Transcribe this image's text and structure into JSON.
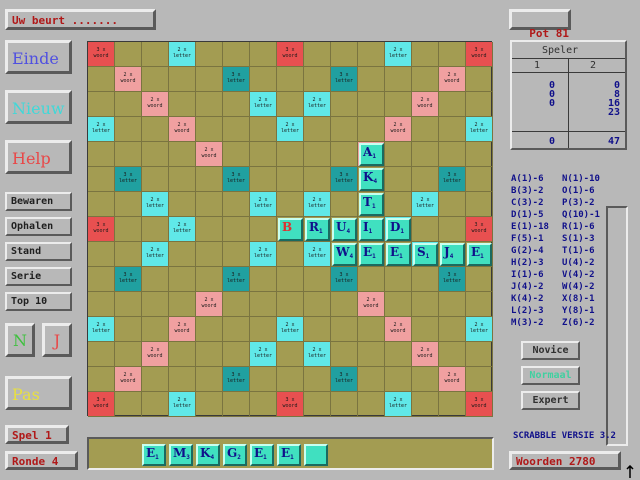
{
  "status_top": "Uw beurt .......",
  "pot": {
    "label": "Pot",
    "value": "81"
  },
  "buttons": {
    "einde": "Einde",
    "nieuw": "Nieuw",
    "help": "Help",
    "bewaren": "Bewaren",
    "ophalen": "Ophalen",
    "stand": "Stand",
    "serie": "Serie",
    "top10": "Top 10",
    "n": "N",
    "j": "J",
    "pas": "Pas"
  },
  "spel": "Spel 1",
  "ronde": "Ronde 4",
  "score": {
    "title": "Speler",
    "col1": "1",
    "col2": "2",
    "p1": [
      "0",
      "0",
      "0"
    ],
    "p2": [
      "0",
      "8",
      "16",
      "23"
    ],
    "total1": "0",
    "total2": "47"
  },
  "letter_values_left": [
    "A(1)-6",
    "B(3)-2",
    "C(3)-2",
    "D(1)-5",
    "E(1)-18",
    "F(5)-1",
    "G(2)-4",
    "H(2)-3",
    "I(1)-6",
    "J(4)-2",
    "K(4)-2",
    "L(2)-3",
    "M(3)-2"
  ],
  "letter_values_right": [
    "N(1)-10",
    "O(1)-6",
    "P(3)-2",
    "Q(10)-1",
    "R(1)-6",
    "S(1)-3",
    "T(1)-6",
    "U(4)-2",
    "V(4)-2",
    "W(4)-2",
    "X(8)-1",
    "Y(8)-1",
    "Z(6)-2"
  ],
  "levels": {
    "novice": "Novice",
    "normaal": "Normaal",
    "expert": "Expert"
  },
  "version": "SCRABBLE VERSIE 3.2",
  "woorden": "Woorden 2780",
  "bonus_labels": {
    "wt": "3 x woord",
    "dw": "2 x woord",
    "tl": "3 x letter",
    "dl": "2 x letter"
  },
  "colors": {
    "board": "#a39c52",
    "tw": "#e85050",
    "dw": "#f0a0a0",
    "tl": "#20a0a0",
    "dl": "#60e8e8",
    "tile": "#40e0c0"
  },
  "placed_tiles": [
    {
      "letter": "A",
      "value": "1"
    },
    {
      "letter": "K",
      "value": "4"
    },
    {
      "letter": "T",
      "value": "1"
    },
    {
      "letter": "B",
      "value": ""
    },
    {
      "letter": "R",
      "value": "1"
    },
    {
      "letter": "U",
      "value": "4"
    },
    {
      "letter": "I",
      "value": "1"
    },
    {
      "letter": "D",
      "value": "1"
    },
    {
      "letter": "W",
      "value": "4"
    },
    {
      "letter": "E",
      "value": "1"
    },
    {
      "letter": "E",
      "value": "1"
    },
    {
      "letter": "S",
      "value": "1"
    },
    {
      "letter": "J",
      "value": "4"
    },
    {
      "letter": "E",
      "value": "1"
    }
  ],
  "rack": [
    {
      "letter": "E",
      "value": "1"
    },
    {
      "letter": "M",
      "value": "3"
    },
    {
      "letter": "K",
      "value": "4"
    },
    {
      "letter": "G",
      "value": "2"
    },
    {
      "letter": "E",
      "value": "1"
    },
    {
      "letter": "E",
      "value": "1"
    },
    {
      "letter": "",
      "value": ""
    }
  ]
}
